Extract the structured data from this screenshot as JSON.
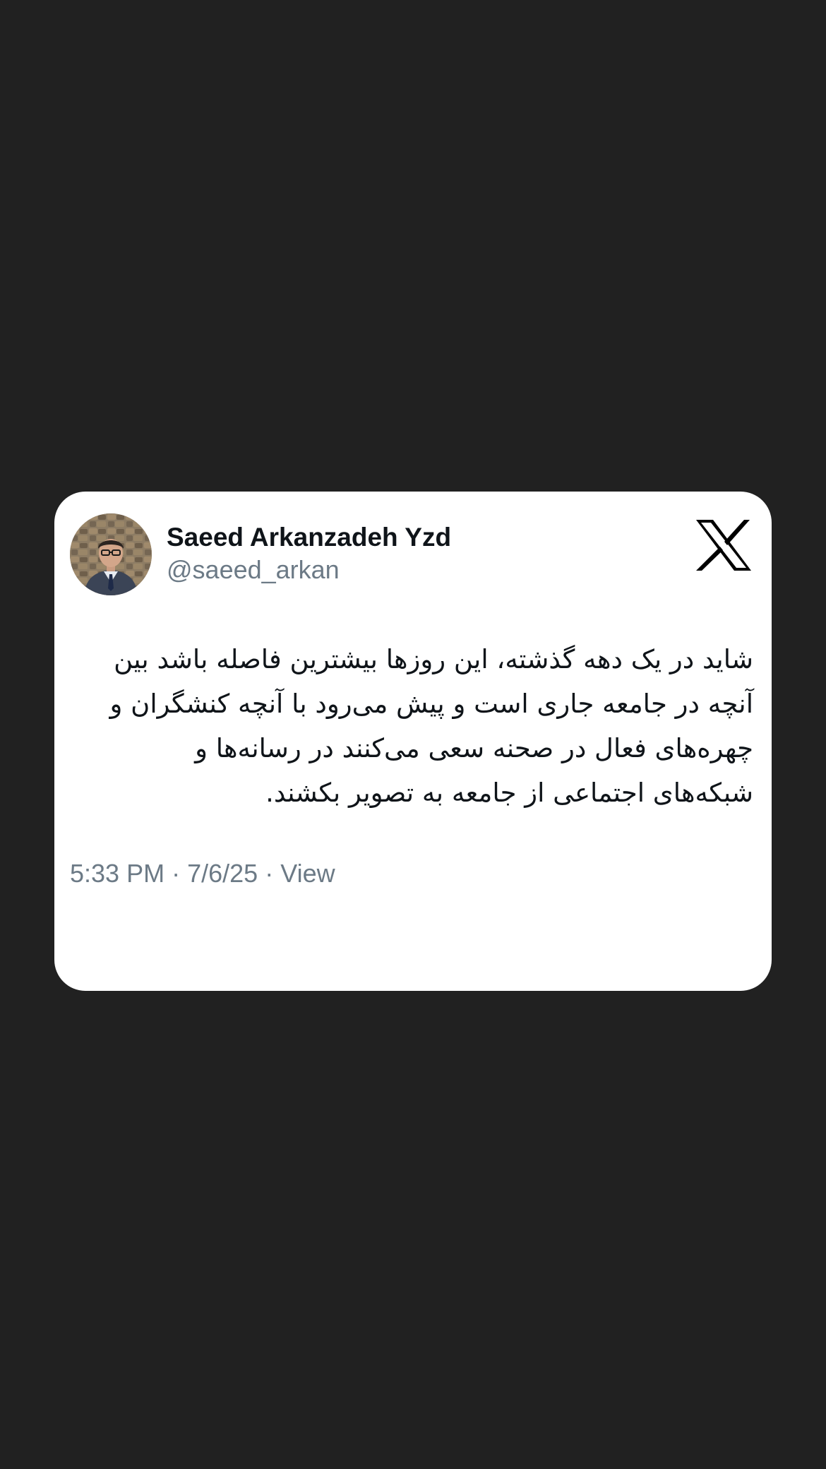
{
  "tweet": {
    "author_name": "Saeed Arkanzadeh Yzd",
    "author_handle": "@saeed_arkan",
    "text": "شاید در یک دهه گذشته، این روزها بیشترین فاصله باشد بین آنچه در جامعه جاری است و پیش می‌رود با آنچه کنشگران و چهره‌های فعال در صحنه سعی می‌کنند در رسانه‌ها و شبکه‌های اجتماعی از جامعه به تصویر بکشند.",
    "time": "5:33 PM",
    "date": "7/6/25",
    "view_label": "View",
    "separator": "·"
  },
  "icons": {
    "brand": "x-logo-icon",
    "avatar": "profile-photo"
  },
  "colors": {
    "background": "#212121",
    "card": "#ffffff",
    "text_primary": "#0f1419",
    "text_secondary": "#6c7a86"
  }
}
